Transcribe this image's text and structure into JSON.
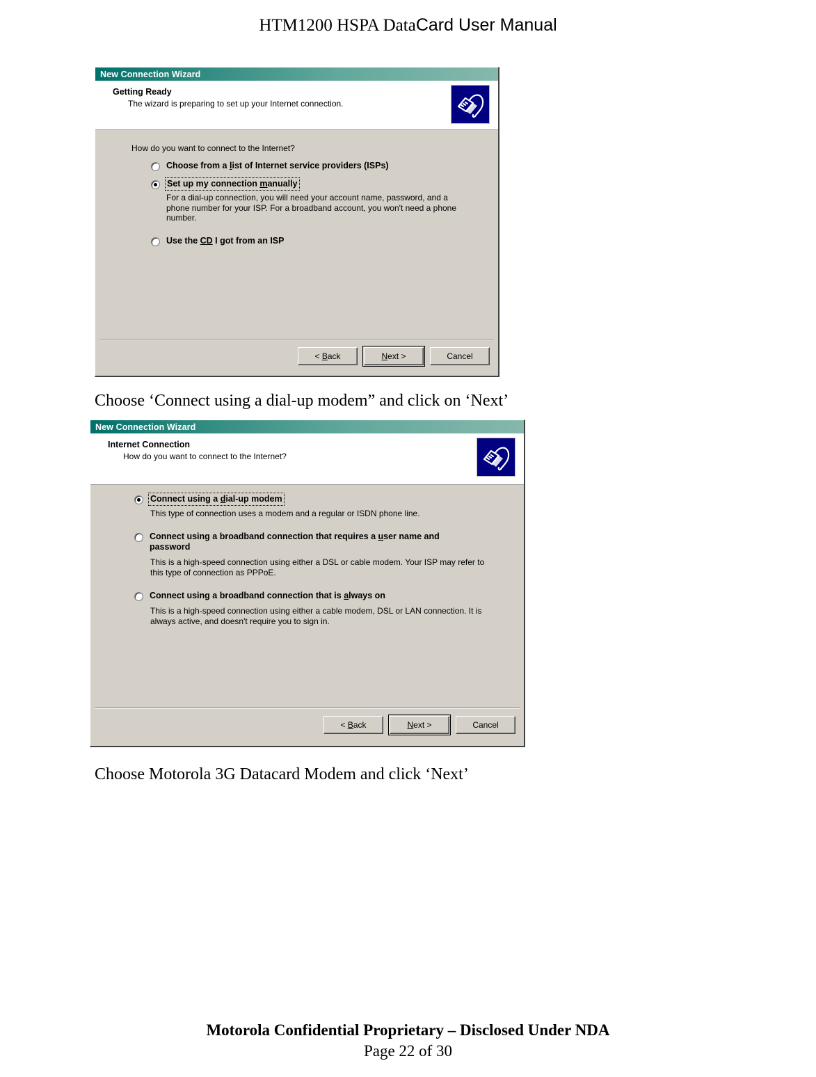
{
  "page": {
    "header_serif": "HTM1200 HSPA Data",
    "header_sans": "Card User Manual",
    "footer_confidential": "Motorola Confidential Proprietary – Disclosed Under NDA",
    "footer_page": "Page 22 of 30"
  },
  "colors": {
    "titlebar_start": "#00706a",
    "titlebar_end": "#86b8ac",
    "dialog_face": "#d4d0c8",
    "icon_bg": "#000080"
  },
  "dialog1": {
    "title": "New Connection Wizard",
    "head_title": "Getting Ready",
    "head_sub": "The wizard is preparing to set up your Internet connection.",
    "icon_name": "network-plug-icon",
    "prompt": "How do you want to connect to the Internet?",
    "options": [
      {
        "label_pre": "Choose from a ",
        "label_accel": "l",
        "label_post": "ist of Internet service providers (ISPs)",
        "selected": false,
        "focused": false,
        "desc": ""
      },
      {
        "label_pre": "Set up my connection ",
        "label_accel": "m",
        "label_post": "anually",
        "selected": true,
        "focused": true,
        "desc": "For a dial-up connection, you will need your account name, password, and a phone number for your ISP. For a broadband account, you won't need a phone number."
      },
      {
        "label_pre": "Use the ",
        "label_accel": "CD",
        "label_post": " I got from an ISP",
        "selected": false,
        "focused": false,
        "desc": ""
      }
    ],
    "buttons": {
      "back_pre": "< ",
      "back_accel": "B",
      "back_post": "ack",
      "next_accel": "N",
      "next_post": "ext >",
      "cancel": "Cancel"
    }
  },
  "caption1": "Choose ‘Connect using a dial-up modem” and click on ‘Next’",
  "dialog2": {
    "title": "New Connection Wizard",
    "head_title": "Internet Connection",
    "head_sub": "How do you want to connect to the Internet?",
    "icon_name": "network-plug-icon",
    "options": [
      {
        "label_pre": "Connect using a ",
        "label_accel": "d",
        "label_post": "ial-up modem",
        "selected": true,
        "focused": true,
        "desc": "This type of connection uses a modem and a regular or ISDN phone line."
      },
      {
        "label_pre": "Connect using a broadband connection that requires a ",
        "label_accel": "u",
        "label_post": "ser name and password",
        "selected": false,
        "focused": false,
        "desc": "This is a high-speed connection using either a DSL or cable modem. Your ISP may refer to this type of connection as PPPoE."
      },
      {
        "label_pre": "Connect using a broadband connection that is ",
        "label_accel": "a",
        "label_post": "lways on",
        "selected": false,
        "focused": false,
        "desc": "This is a high-speed connection using either a cable modem, DSL or LAN connection. It is always active, and doesn't require you to sign in."
      }
    ],
    "buttons": {
      "back_pre": "< ",
      "back_accel": "B",
      "back_post": "ack",
      "next_accel": "N",
      "next_post": "ext >",
      "cancel": "Cancel"
    }
  },
  "caption2": "Choose Motorola 3G Datacard Modem and click ‘Next’"
}
